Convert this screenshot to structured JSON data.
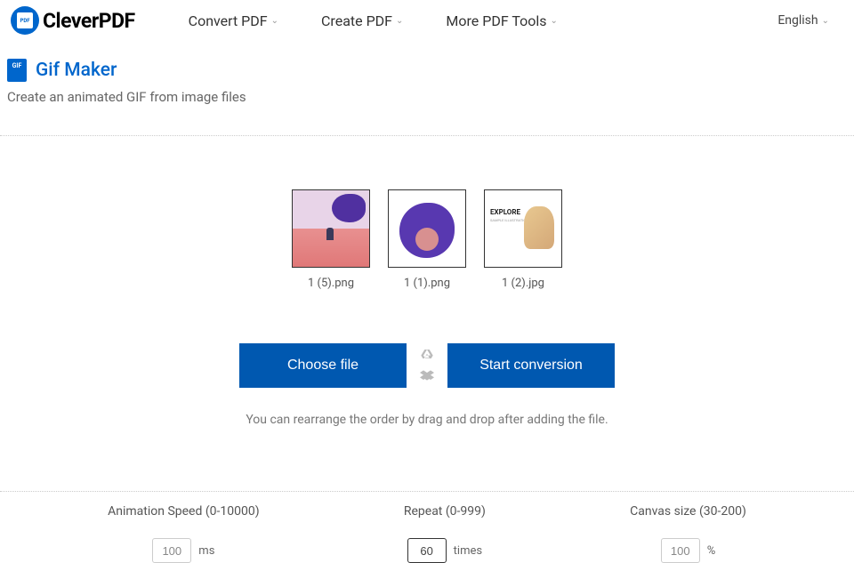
{
  "brand": "CleverPDF",
  "nav": {
    "items": [
      {
        "label": "Convert PDF"
      },
      {
        "label": "Create PDF"
      },
      {
        "label": "More PDF Tools"
      }
    ],
    "lang": "English"
  },
  "page": {
    "title": "Gif Maker",
    "subtitle": "Create an animated GIF from image files"
  },
  "thumbs": [
    {
      "filename": "1 (5).png"
    },
    {
      "filename": "1 (1).png"
    },
    {
      "filename": "1 (2).jpg"
    }
  ],
  "thumb3": {
    "heading": "EXPLORE",
    "sub": "SAMPLE ILLUSTRATION"
  },
  "buttons": {
    "choose": "Choose file",
    "start": "Start conversion"
  },
  "hint": "You can rearrange the order by drag and drop after adding the file.",
  "settings": {
    "speed": {
      "label": "Animation Speed (0-10000)",
      "value": "100",
      "unit": "ms"
    },
    "repeat": {
      "label": "Repeat (0-999)",
      "value": "60",
      "unit": "times"
    },
    "canvas": {
      "label": "Canvas size (30-200)",
      "value": "100",
      "unit": "%"
    }
  }
}
